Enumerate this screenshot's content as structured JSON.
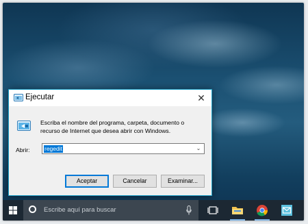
{
  "dialog": {
    "title": "Ejecutar",
    "close_glyph": "✕",
    "message": "Escriba el nombre del programa, carpeta, documento o recurso de Internet que desea abrir con Windows.",
    "open_label": "Abrir:",
    "open_value": "regedit",
    "buttons": {
      "ok": "Aceptar",
      "cancel": "Cancelar",
      "browse": "Examinar..."
    }
  },
  "taskbar": {
    "search_placeholder": "Escribe aquí para buscar",
    "icons": [
      "windows-start-icon",
      "cortana-icon",
      "microphone-icon",
      "task-view-icon",
      "file-explorer-icon",
      "chrome-icon",
      "mail-icon"
    ]
  },
  "colors": {
    "accent": "#0078d7",
    "dialog_border": "#1aa0c8",
    "taskbar": "#1c2833"
  }
}
